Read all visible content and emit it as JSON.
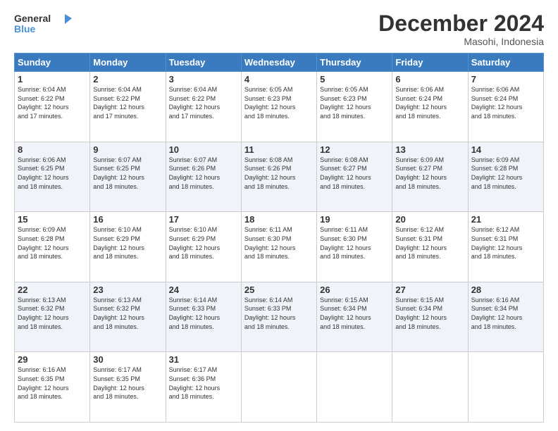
{
  "header": {
    "logo_general": "General",
    "logo_blue": "Blue",
    "month_title": "December 2024",
    "location": "Masohi, Indonesia"
  },
  "days_of_week": [
    "Sunday",
    "Monday",
    "Tuesday",
    "Wednesday",
    "Thursday",
    "Friday",
    "Saturday"
  ],
  "weeks": [
    [
      {
        "day": "1",
        "sunrise": "6:04 AM",
        "sunset": "6:22 PM",
        "daylight": "12 hours and 17 minutes."
      },
      {
        "day": "2",
        "sunrise": "6:04 AM",
        "sunset": "6:22 PM",
        "daylight": "12 hours and 17 minutes."
      },
      {
        "day": "3",
        "sunrise": "6:04 AM",
        "sunset": "6:22 PM",
        "daylight": "12 hours and 17 minutes."
      },
      {
        "day": "4",
        "sunrise": "6:05 AM",
        "sunset": "6:23 PM",
        "daylight": "12 hours and 18 minutes."
      },
      {
        "day": "5",
        "sunrise": "6:05 AM",
        "sunset": "6:23 PM",
        "daylight": "12 hours and 18 minutes."
      },
      {
        "day": "6",
        "sunrise": "6:06 AM",
        "sunset": "6:24 PM",
        "daylight": "12 hours and 18 minutes."
      },
      {
        "day": "7",
        "sunrise": "6:06 AM",
        "sunset": "6:24 PM",
        "daylight": "12 hours and 18 minutes."
      }
    ],
    [
      {
        "day": "8",
        "sunrise": "6:06 AM",
        "sunset": "6:25 PM",
        "daylight": "12 hours and 18 minutes."
      },
      {
        "day": "9",
        "sunrise": "6:07 AM",
        "sunset": "6:25 PM",
        "daylight": "12 hours and 18 minutes."
      },
      {
        "day": "10",
        "sunrise": "6:07 AM",
        "sunset": "6:26 PM",
        "daylight": "12 hours and 18 minutes."
      },
      {
        "day": "11",
        "sunrise": "6:08 AM",
        "sunset": "6:26 PM",
        "daylight": "12 hours and 18 minutes."
      },
      {
        "day": "12",
        "sunrise": "6:08 AM",
        "sunset": "6:27 PM",
        "daylight": "12 hours and 18 minutes."
      },
      {
        "day": "13",
        "sunrise": "6:09 AM",
        "sunset": "6:27 PM",
        "daylight": "12 hours and 18 minutes."
      },
      {
        "day": "14",
        "sunrise": "6:09 AM",
        "sunset": "6:28 PM",
        "daylight": "12 hours and 18 minutes."
      }
    ],
    [
      {
        "day": "15",
        "sunrise": "6:09 AM",
        "sunset": "6:28 PM",
        "daylight": "12 hours and 18 minutes."
      },
      {
        "day": "16",
        "sunrise": "6:10 AM",
        "sunset": "6:29 PM",
        "daylight": "12 hours and 18 minutes."
      },
      {
        "day": "17",
        "sunrise": "6:10 AM",
        "sunset": "6:29 PM",
        "daylight": "12 hours and 18 minutes."
      },
      {
        "day": "18",
        "sunrise": "6:11 AM",
        "sunset": "6:30 PM",
        "daylight": "12 hours and 18 minutes."
      },
      {
        "day": "19",
        "sunrise": "6:11 AM",
        "sunset": "6:30 PM",
        "daylight": "12 hours and 18 minutes."
      },
      {
        "day": "20",
        "sunrise": "6:12 AM",
        "sunset": "6:31 PM",
        "daylight": "12 hours and 18 minutes."
      },
      {
        "day": "21",
        "sunrise": "6:12 AM",
        "sunset": "6:31 PM",
        "daylight": "12 hours and 18 minutes."
      }
    ],
    [
      {
        "day": "22",
        "sunrise": "6:13 AM",
        "sunset": "6:32 PM",
        "daylight": "12 hours and 18 minutes."
      },
      {
        "day": "23",
        "sunrise": "6:13 AM",
        "sunset": "6:32 PM",
        "daylight": "12 hours and 18 minutes."
      },
      {
        "day": "24",
        "sunrise": "6:14 AM",
        "sunset": "6:33 PM",
        "daylight": "12 hours and 18 minutes."
      },
      {
        "day": "25",
        "sunrise": "6:14 AM",
        "sunset": "6:33 PM",
        "daylight": "12 hours and 18 minutes."
      },
      {
        "day": "26",
        "sunrise": "6:15 AM",
        "sunset": "6:34 PM",
        "daylight": "12 hours and 18 minutes."
      },
      {
        "day": "27",
        "sunrise": "6:15 AM",
        "sunset": "6:34 PM",
        "daylight": "12 hours and 18 minutes."
      },
      {
        "day": "28",
        "sunrise": "6:16 AM",
        "sunset": "6:34 PM",
        "daylight": "12 hours and 18 minutes."
      }
    ],
    [
      {
        "day": "29",
        "sunrise": "6:16 AM",
        "sunset": "6:35 PM",
        "daylight": "12 hours and 18 minutes."
      },
      {
        "day": "30",
        "sunrise": "6:17 AM",
        "sunset": "6:35 PM",
        "daylight": "12 hours and 18 minutes."
      },
      {
        "day": "31",
        "sunrise": "6:17 AM",
        "sunset": "6:36 PM",
        "daylight": "12 hours and 18 minutes."
      },
      null,
      null,
      null,
      null
    ]
  ],
  "labels": {
    "sunrise": "Sunrise:",
    "sunset": "Sunset:",
    "daylight": "Daylight:"
  }
}
